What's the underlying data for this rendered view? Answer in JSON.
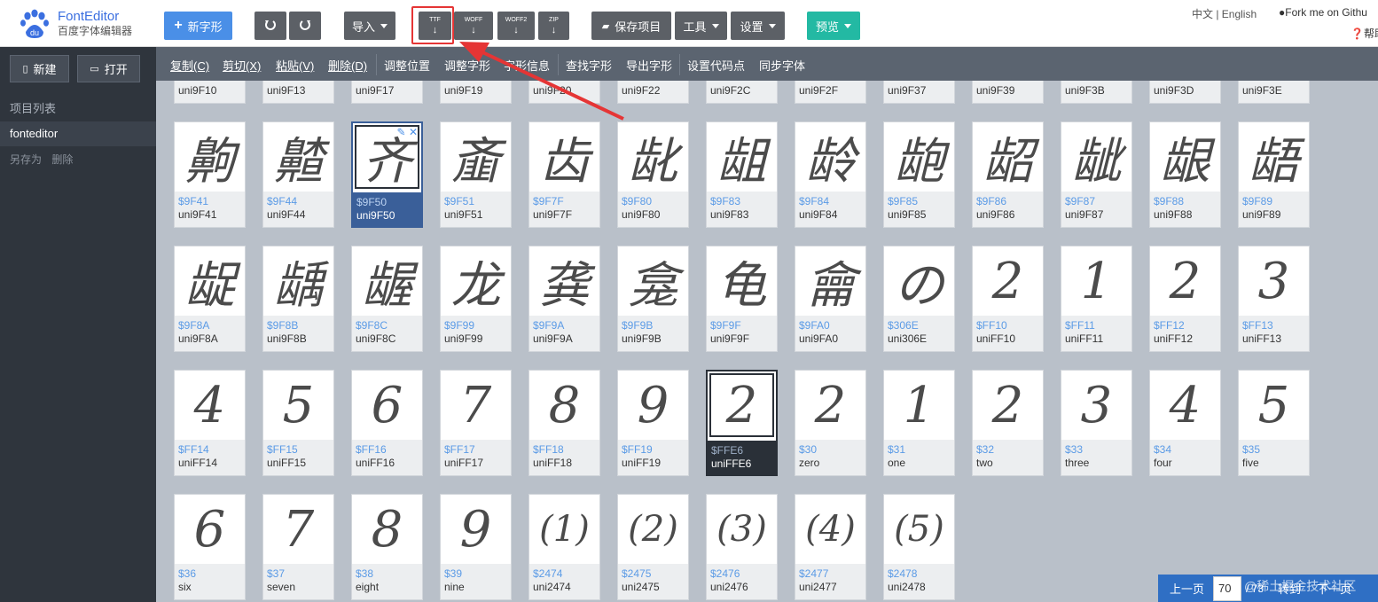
{
  "brand": {
    "name": "FontEditor",
    "subtitle": "百度字体编辑器"
  },
  "toolbar": {
    "new_glyph": "新字形",
    "import": "导入",
    "export_ttf": "TTF",
    "export_woff": "WOFF",
    "export_woff2": "WOFF2",
    "export_zip": "ZIP",
    "save": "保存项目",
    "tools": "工具",
    "settings": "设置",
    "preview": "预览"
  },
  "header_links": {
    "lang": "中文 | English",
    "fork": "Fork me on Githu",
    "help": "帮助"
  },
  "sidebar": {
    "new": "新建",
    "open": "打开",
    "project_list": "项目列表",
    "current_project": "fonteditor",
    "save_as": "另存为",
    "delete": "删除"
  },
  "editbar": {
    "copy": "复制(C)",
    "cut": "剪切(X)",
    "paste": "粘贴(V)",
    "remove": "删除(D)",
    "adjust_pos": "调整位置",
    "adjust_glyph": "调整字形",
    "glyph_info": "字形信息",
    "find_glyph": "查找字形",
    "export_glyph": "导出字形",
    "set_codepoint": "设置代码点",
    "sync_font": "同步字体"
  },
  "top_row": [
    "uni9F10",
    "uni9F13",
    "uni9F17",
    "uni9F19",
    "uni9F20",
    "uni9F22",
    "uni9F2C",
    "uni9F2F",
    "uni9F37",
    "uni9F39",
    "uni9F3B",
    "uni9F3D",
    "uni9F3E"
  ],
  "glyph_rows": [
    [
      {
        "g": "齁",
        "code": "$9F41",
        "name": "uni9F41"
      },
      {
        "g": "齄",
        "code": "$9F44",
        "name": "uni9F44"
      },
      {
        "g": "齐",
        "code": "$9F50",
        "name": "uni9F50",
        "state": "selected"
      },
      {
        "g": "齑",
        "code": "$9F51",
        "name": "uni9F51"
      },
      {
        "g": "齿",
        "code": "$9F7F",
        "name": "uni9F7F"
      },
      {
        "g": "龀",
        "code": "$9F80",
        "name": "uni9F80"
      },
      {
        "g": "龃",
        "code": "$9F83",
        "name": "uni9F83"
      },
      {
        "g": "龄",
        "code": "$9F84",
        "name": "uni9F84"
      },
      {
        "g": "龅",
        "code": "$9F85",
        "name": "uni9F85"
      },
      {
        "g": "龆",
        "code": "$9F86",
        "name": "uni9F86"
      },
      {
        "g": "龇",
        "code": "$9F87",
        "name": "uni9F87"
      },
      {
        "g": "龈",
        "code": "$9F88",
        "name": "uni9F88"
      },
      {
        "g": "龉",
        "code": "$9F89",
        "name": "uni9F89"
      }
    ],
    [
      {
        "g": "龊",
        "code": "$9F8A",
        "name": "uni9F8A"
      },
      {
        "g": "龋",
        "code": "$9F8B",
        "name": "uni9F8B"
      },
      {
        "g": "龌",
        "code": "$9F8C",
        "name": "uni9F8C"
      },
      {
        "g": "龙",
        "code": "$9F99",
        "name": "uni9F99"
      },
      {
        "g": "龚",
        "code": "$9F9A",
        "name": "uni9F9A"
      },
      {
        "g": "龛",
        "code": "$9F9B",
        "name": "uni9F9B"
      },
      {
        "g": "龟",
        "code": "$9F9F",
        "name": "uni9F9F"
      },
      {
        "g": "龠",
        "code": "$9FA0",
        "name": "uni9FA0"
      },
      {
        "g": "の",
        "code": "$306E",
        "name": "uni306E"
      },
      {
        "g": "2",
        "code": "$FF10",
        "name": "uniFF10"
      },
      {
        "g": "1",
        "code": "$FF11",
        "name": "uniFF11"
      },
      {
        "g": "2",
        "code": "$FF12",
        "name": "uniFF12"
      },
      {
        "g": "3",
        "code": "$FF13",
        "name": "uniFF13"
      }
    ],
    [
      {
        "g": "4",
        "code": "$FF14",
        "name": "uniFF14"
      },
      {
        "g": "5",
        "code": "$FF15",
        "name": "uniFF15"
      },
      {
        "g": "6",
        "code": "$FF16",
        "name": "uniFF16"
      },
      {
        "g": "7",
        "code": "$FF17",
        "name": "uniFF17"
      },
      {
        "g": "8",
        "code": "$FF18",
        "name": "uniFF18"
      },
      {
        "g": "9",
        "code": "$FF19",
        "name": "uniFF19"
      },
      {
        "g": "2",
        "code": "$FFE6",
        "name": "uniFFE6",
        "state": "dark"
      },
      {
        "g": "2",
        "code": "$30",
        "name": "zero"
      },
      {
        "g": "1",
        "code": "$31",
        "name": "one"
      },
      {
        "g": "2",
        "code": "$32",
        "name": "two"
      },
      {
        "g": "3",
        "code": "$33",
        "name": "three"
      },
      {
        "g": "4",
        "code": "$34",
        "name": "four"
      },
      {
        "g": "5",
        "code": "$35",
        "name": "five"
      }
    ],
    [
      {
        "g": "6",
        "code": "$36",
        "name": "six"
      },
      {
        "g": "7",
        "code": "$37",
        "name": "seven"
      },
      {
        "g": "8",
        "code": "$38",
        "name": "eight"
      },
      {
        "g": "9",
        "code": "$39",
        "name": "nine"
      },
      {
        "g": "(1)",
        "code": "$2474",
        "name": "uni2474"
      },
      {
        "g": "(2)",
        "code": "$2475",
        "name": "uni2475"
      },
      {
        "g": "(3)",
        "code": "$2476",
        "name": "uni2476"
      },
      {
        "g": "(4)",
        "code": "$2477",
        "name": "uni2477"
      },
      {
        "g": "(5)",
        "code": "$2478",
        "name": "uni2478"
      }
    ]
  ],
  "pager": {
    "prev": "上一页",
    "page": "70",
    "total": "/ 73",
    "goto": "转到",
    "next": "下一页"
  },
  "watermark": "@稀土掘金技术社区",
  "colors": {
    "accent_blue": "#4a8fe7",
    "preview_green": "#23b9a3",
    "highlight_red": "#e53535",
    "selected": "#3a5f99"
  }
}
